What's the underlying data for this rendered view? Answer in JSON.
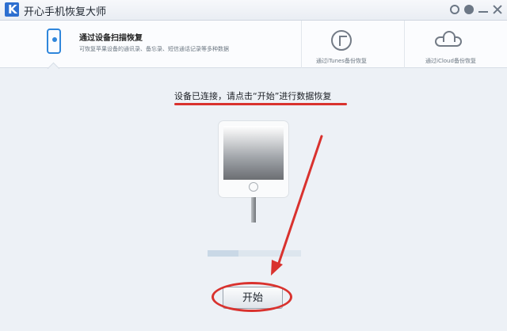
{
  "window": {
    "title": "开心手机恢复大师",
    "logo_letter": "K"
  },
  "title_icons": [
    "wechat-icon",
    "message-icon",
    "minimize-icon",
    "close-icon"
  ],
  "tabs": {
    "scan": {
      "title": "通过设备扫描恢复",
      "desc": "可恢复苹果设备的通讯录、备忘录、短信通话记录等多种数据"
    },
    "itunes": {
      "label": "通过iTunes备份恢复"
    },
    "icloud": {
      "label": "通过iCloud备份恢复"
    }
  },
  "status": {
    "text": "设备已连接，请点击“开始”进行数据恢复"
  },
  "progress": {
    "value": 0.33
  },
  "actions": {
    "start_label": "开始"
  },
  "colors": {
    "annotation_red": "#d9322e",
    "accent_blue": "#2f86db"
  }
}
